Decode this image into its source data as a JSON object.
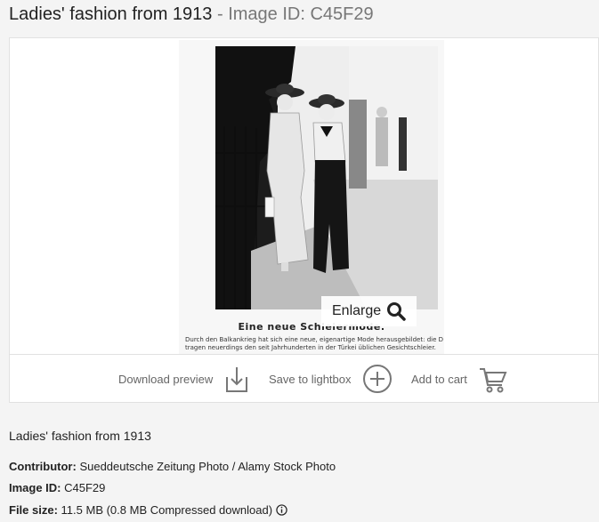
{
  "header": {
    "title": "Ladies' fashion from 1913",
    "separator": " - ",
    "image_id_label": "Image ID: C45F29"
  },
  "preview": {
    "caption_title": "Eine neue Schleiermode.",
    "caption_text_1": "Durch den Balkankrieg hat sich eine neue, eigenartige Mode herausgebildet: die Damen",
    "caption_text_2": "tragen neuerdings den seit Jahrhunderten in der Türkei üblichen Gesichtschleier.",
    "enlarge_label": "Enlarge"
  },
  "actions": {
    "download_preview": "Download preview",
    "save_to_lightbox": "Save to lightbox",
    "add_to_cart": "Add to cart"
  },
  "details": {
    "description": "Ladies' fashion from 1913",
    "contributor_label": "Contributor:",
    "contributor_value": "Sueddeutsche Zeitung Photo / Alamy Stock Photo",
    "image_id_label": "Image ID:",
    "image_id_value": "C45F29",
    "file_size_label": "File size:",
    "file_size_value": "11.5 MB (0.8 MB Compressed download)"
  },
  "colors": {
    "background": "#f4f4f4",
    "card": "#ffffff",
    "muted_text": "#666666",
    "icon_gray": "#777777"
  }
}
